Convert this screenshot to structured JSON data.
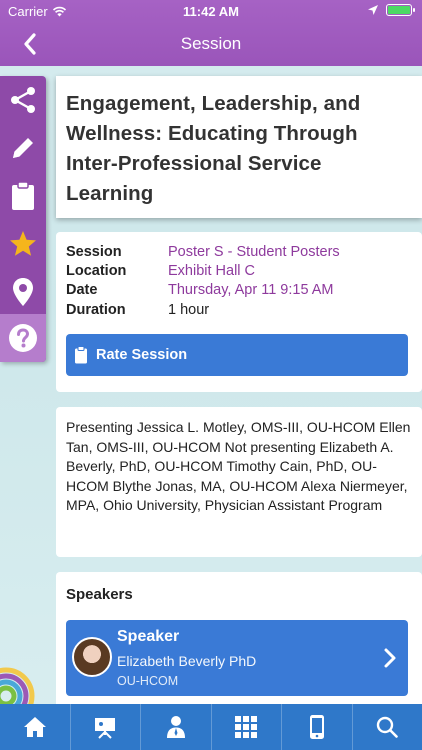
{
  "status": {
    "carrier": "Carrier",
    "time": "11:42 AM"
  },
  "header": {
    "title": "Session"
  },
  "rail": {
    "items": [
      "share-icon",
      "pencil-icon",
      "clipboard-icon",
      "star-icon",
      "map-pin-icon",
      "help-icon"
    ]
  },
  "session": {
    "title": "Engagement, Leadership, and Wellness: Educating Through Inter-Professional Service Learning",
    "labels": {
      "session": "Session",
      "location": "Location",
      "date": "Date",
      "duration": "Duration"
    },
    "session_value": "Poster S - Student Posters",
    "location_value": "Exhibit Hall C",
    "date_value": "Thursday, Apr 11 9:15 AM",
    "duration_value": "1 hour",
    "rate_label": "Rate Session"
  },
  "description": "Presenting Jessica L. Motley, OMS-III, OU-HCOM Ellen Tan, OMS-III, OU-HCOM Not presenting Elizabeth A. Beverly, PhD, OU-HCOM Timothy Cain, PhD, OU-HCOM Blythe Jonas, MA, OU-HCOM Alexa Niermeyer, MPA, Ohio University, Physician Assistant Program",
  "speakers": {
    "heading": "Speakers",
    "items": [
      {
        "role": "Speaker",
        "name": "Elizabeth Beverly PhD",
        "org": "OU-HCOM"
      }
    ]
  },
  "tabbar": {
    "items": [
      "home-icon",
      "presentation-icon",
      "attendee-icon",
      "qr-grid-icon",
      "mobile-icon",
      "search-icon"
    ]
  },
  "colors": {
    "header": "#a05bc0",
    "rail": "#8e4aa8",
    "accent_blue": "#3a7ad6",
    "link_purple": "#8e3a9d",
    "tabbar": "#2f78c9"
  }
}
